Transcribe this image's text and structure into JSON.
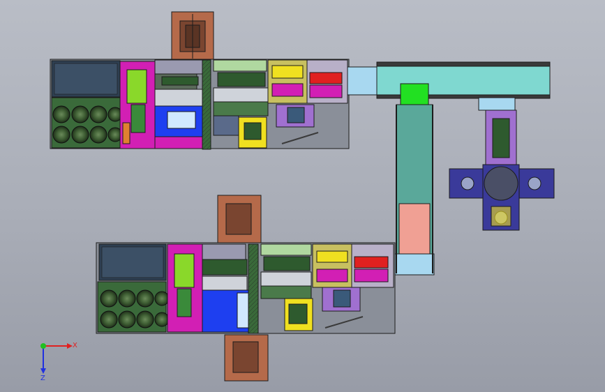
{
  "scene": {
    "view": "top",
    "colors": {
      "outline": "#1c1c1c",
      "brown": "#8a5a3a",
      "orange_red": "#e0603a",
      "magenta": "#d21fb4",
      "dark_green": "#2e5a2e",
      "olive": "#7a8a5a",
      "gray_blue": "#5c6a8a",
      "blue": "#1e3ff0",
      "cyan": "#7fd8d0",
      "teal": "#5aa89a",
      "green": "#22e022",
      "salmon": "#f0a094",
      "light_blue": "#a8d8f0",
      "yellow": "#f0e020",
      "purple": "#a070d0",
      "navy": "#3a3a9a",
      "red": "#e02020"
    }
  },
  "triad": {
    "x_label": "X",
    "z_label": "Z",
    "x_color": "#e02020",
    "z_color": "#2030e0",
    "y_color": "#20c020"
  }
}
